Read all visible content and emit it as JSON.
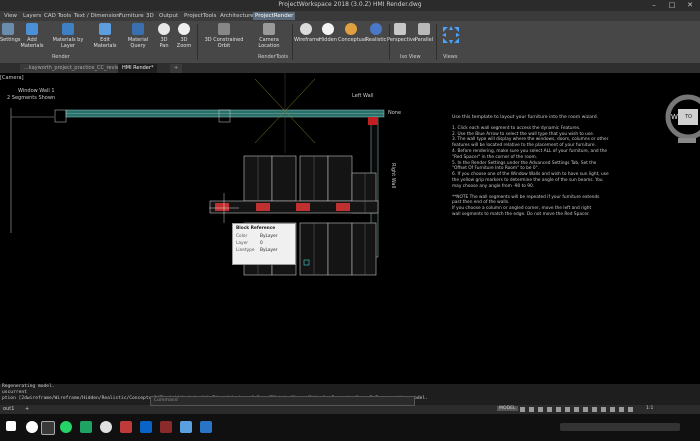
{
  "app": {
    "title": "ProjectWorkspace 2018 (3.0.Z)    HMI Render.dwg"
  },
  "menu_tabs": [
    "View",
    "Layers",
    "CAD Tools",
    "Text / Dimension",
    "Furniture",
    "3D",
    "Output",
    "ProjectTools",
    "Architecture",
    "ProjectRender"
  ],
  "ribbon": {
    "buttons": [
      "Settings",
      "Add Materials",
      "Materials by Layer",
      "Edit Materials",
      "Material Query",
      "3D Pan",
      "3D Zoom",
      "3D Constrained Orbit",
      "Camera Location",
      "Wireframe",
      "Hidden",
      "Conceptual",
      "Realistic",
      "Perspective",
      "Parallel"
    ],
    "panels": [
      "Render",
      "RenderTools",
      "Iso View",
      "Views"
    ]
  },
  "doc_tabs": [
    "...kayworth_project_practice_CC_revised*",
    "HMI Render*"
  ],
  "doc_tab_add": "+",
  "canvas": {
    "viewport_label": "[Camera]",
    "window_wall_label": "Window Wall 1",
    "segments_label": "2 Segments Shown",
    "left_wall_label": "Left Wall",
    "none_label": "None",
    "right_wall_label": "Right Wall",
    "notes_title": "Use this template to layout your furniture into the room wizard.",
    "notes": [
      "1.   Click each wall segment to access the dynamic Features.",
      "2.   Use the Blue Arrow to select the wall type that you wish to use.",
      "3.   The wall type will display where the windows, doors, columns or other",
      "      features will be located relative to the placement of your furniture.",
      "4.   Before rendering, make sure you select ALL of your furniture, and the",
      "      \"Red Spacer\" in the corner of the room.",
      "5.   In the Render Settings under the Advanced Settings Tab, Set the",
      "      \"Offset Of Furniture Into Room\" to be 0\".",
      "6.   If you choose one of the Window Walls and wish to have sun light, use",
      "      the yellow grip markers to determine the angle of the sun beams.  You",
      "      may choose any angle from -90 to 90.",
      "",
      "   **NOTE      The wall segments will be repeated if your furniture extends",
      "                past then end of the walls.",
      "                If you choose a column or angled corner, move the left and right",
      "         wall segments to match the edge.  Do not move the Red Spacer."
    ]
  },
  "tooltip": {
    "title": "Block Reference",
    "rows": [
      {
        "key": "Color",
        "value": "ByLayer"
      },
      {
        "key": "Layer",
        "value": "0"
      },
      {
        "key": "Linetype",
        "value": "ByLayer"
      }
    ]
  },
  "compass": {
    "w": "W",
    "top": "TO"
  },
  "command": {
    "line1": "Regenerating model.",
    "line2": "uscurrent",
    "line3": "ption [2dwireframe/Wireframe/Hidden/Realistic/Conceptual/Shaded/shaded with Edges/shades of Gray/SKetchy/X-ray/Other] <Conceptual>: _2 Regenerating model.",
    "placeholder": "Command"
  },
  "layout_tabs": [
    "out1",
    "+"
  ],
  "status": {
    "model": "MODEL",
    "scale": "1:1"
  },
  "taskbar": {
    "time": ""
  }
}
